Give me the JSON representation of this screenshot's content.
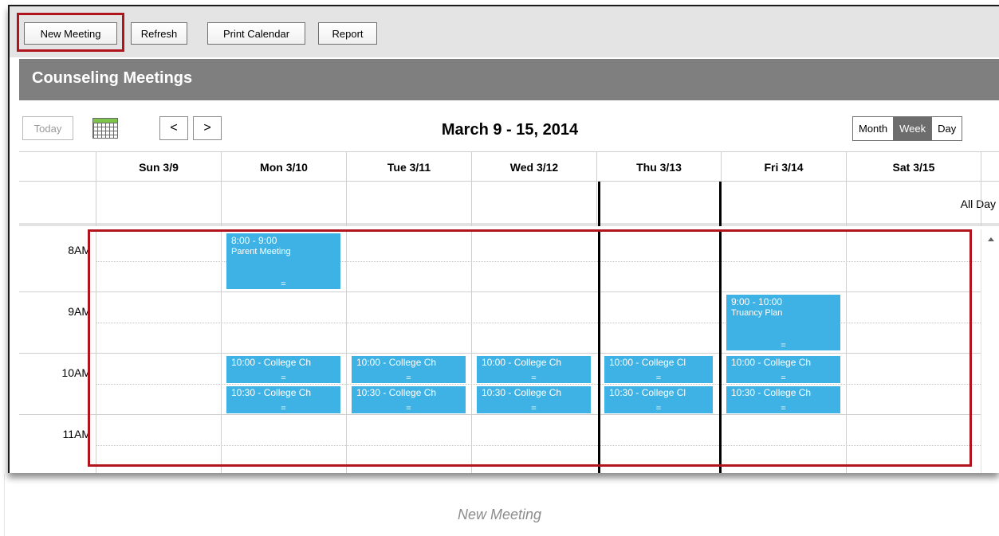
{
  "toolbar": {
    "new_meeting": "New Meeting",
    "refresh": "Refresh",
    "print_calendar": "Print Calendar",
    "report": "Report"
  },
  "title": "Counseling Meetings",
  "nav": {
    "today": "Today",
    "prev": "<",
    "next": ">",
    "date_range": "March 9 - 15, 2014",
    "views": [
      "Month",
      "Week",
      "Day"
    ],
    "active_view": "Week"
  },
  "days": [
    "Sun 3/9",
    "Mon 3/10",
    "Tue 3/11",
    "Wed 3/12",
    "Thu 3/13",
    "Fri 3/14",
    "Sat 3/15"
  ],
  "all_day_label": "All Day",
  "hours": [
    "8AM",
    "9AM",
    "10AM",
    "11AM"
  ],
  "events": [
    {
      "day": "Mon 3/10",
      "start": "8:00",
      "end": "9:00",
      "time": "8:00 - 9:00",
      "title": "Parent Meeting"
    },
    {
      "day": "Fri 3/14",
      "start": "9:00",
      "end": "10:00",
      "time": "9:00 - 10:00",
      "title": "Truancy Plan"
    },
    {
      "day": "Mon 3/10",
      "start": "10:00",
      "end": "10:30",
      "time": "10:00 - College Ch"
    },
    {
      "day": "Tue 3/11",
      "start": "10:00",
      "end": "10:30",
      "time": "10:00 - College Ch"
    },
    {
      "day": "Wed 3/12",
      "start": "10:00",
      "end": "10:30",
      "time": "10:00 - College Ch"
    },
    {
      "day": "Thu 3/13",
      "start": "10:00",
      "end": "10:30",
      "time": "10:00 - College Cl"
    },
    {
      "day": "Fri 3/14",
      "start": "10:00",
      "end": "10:30",
      "time": "10:00 - College Ch"
    },
    {
      "day": "Mon 3/10",
      "start": "10:30",
      "end": "11:00",
      "time": "10:30 - College Ch"
    },
    {
      "day": "Tue 3/11",
      "start": "10:30",
      "end": "11:00",
      "time": "10:30 - College Ch"
    },
    {
      "day": "Wed 3/12",
      "start": "10:30",
      "end": "11:00",
      "time": "10:30 - College Ch"
    },
    {
      "day": "Thu 3/13",
      "start": "10:30",
      "end": "11:00",
      "time": "10:30 - College Cl"
    },
    {
      "day": "Fri 3/14",
      "start": "10:30",
      "end": "11:00",
      "time": "10:30 - College Ch"
    }
  ],
  "event_grip": "=",
  "colors": {
    "event": "#3eb2e4",
    "highlight": "#b0151d",
    "title_bar": "#7f7f7f"
  },
  "caption": "New Meeting"
}
